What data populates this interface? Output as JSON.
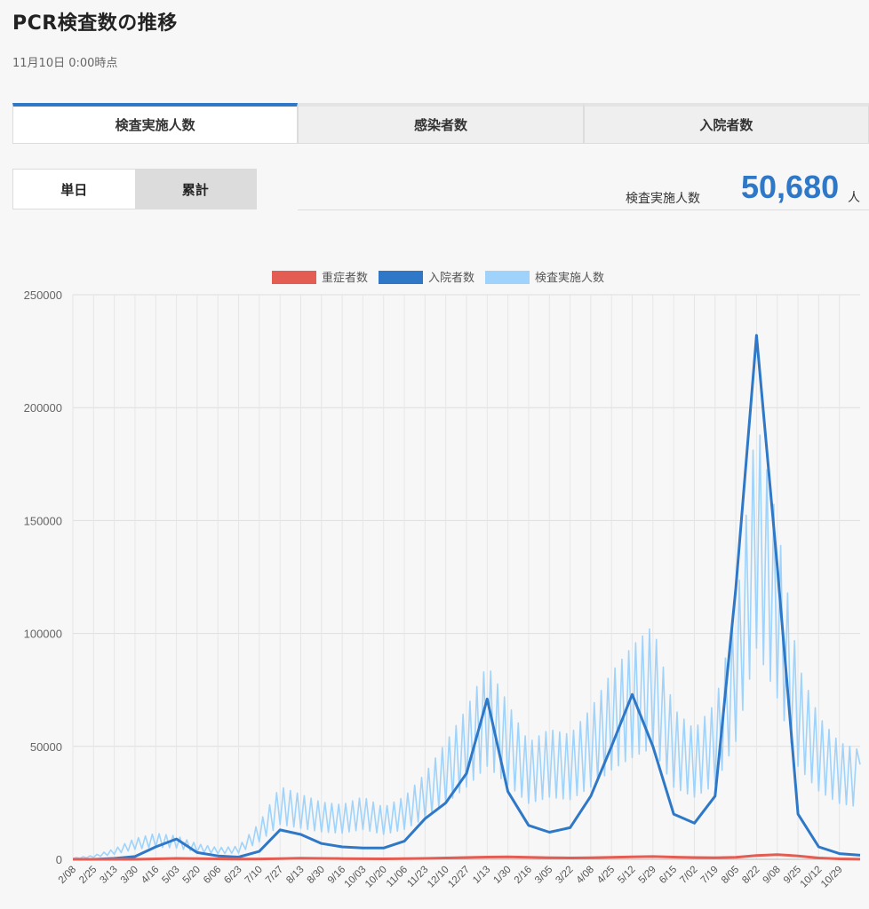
{
  "header": {
    "title": "PCR検査数の推移",
    "timestamp": "11月10日 0:00時点"
  },
  "tabs": [
    {
      "label": "検査実施人数",
      "active": true
    },
    {
      "label": "感染者数",
      "active": false
    },
    {
      "label": "入院者数",
      "active": false
    }
  ],
  "toggle": {
    "daily": "単日",
    "cumulative": "累計",
    "selected": "daily"
  },
  "stat": {
    "label": "検査実施人数",
    "value": "50,680",
    "unit": "人"
  },
  "colors": {
    "severe": "#e35d53",
    "hospitalized": "#2e78c7",
    "tests": "#9fd3fb",
    "accent": "#2e78c7"
  },
  "chart_data": {
    "type": "line",
    "legend": [
      "重症者数",
      "入院者数",
      "検査実施人数"
    ],
    "legend_position": "top",
    "grid": true,
    "ylim": [
      0,
      250000
    ],
    "yticks": [
      "250000",
      "200000",
      "150000",
      "100000",
      "50000",
      "0"
    ],
    "xticks": [
      "2/08",
      "2/25",
      "3/13",
      "3/30",
      "4/16",
      "5/03",
      "5/20",
      "6/06",
      "6/23",
      "7/10",
      "7/27",
      "8/13",
      "8/30",
      "9/16",
      "10/03",
      "10/20",
      "11/06",
      "11/23",
      "12/10",
      "12/27",
      "1/13",
      "1/30",
      "2/16",
      "3/05",
      "3/22",
      "4/08",
      "4/25",
      "5/12",
      "5/29",
      "6/15",
      "7/02",
      "7/19",
      "8/05",
      "8/22",
      "9/08",
      "9/25",
      "10/12",
      "10/29"
    ],
    "series": [
      {
        "name": "重症者数",
        "values": [
          0,
          0,
          0,
          0,
          200,
          400,
          300,
          200,
          100,
          150,
          300,
          500,
          400,
          300,
          250,
          200,
          300,
          400,
          600,
          800,
          1000,
          1100,
          900,
          700,
          600,
          700,
          900,
          1100,
          1200,
          1000,
          800,
          700,
          900,
          1700,
          2100,
          1500,
          600,
          200,
          50
        ]
      },
      {
        "name": "入院者数",
        "values": [
          0,
          0,
          400,
          1200,
          5500,
          9000,
          3000,
          1500,
          1000,
          3500,
          13000,
          11000,
          7000,
          5500,
          5000,
          5000,
          8000,
          18000,
          25000,
          38000,
          71000,
          30000,
          15000,
          12000,
          14000,
          28000,
          50000,
          73000,
          50000,
          20000,
          16000,
          28000,
          120000,
          232000,
          130000,
          20000,
          5500,
          2500,
          1800
        ]
      },
      {
        "name": "検査実施人数",
        "values": [
          500,
          1500,
          4000,
          8000,
          10000,
          9000,
          6000,
          4500,
          5000,
          14000,
          28000,
          25000,
          22000,
          21000,
          24000,
          20000,
          24000,
          33000,
          45000,
          58000,
          75000,
          60000,
          45000,
          50000,
          48000,
          58000,
          72000,
          82000,
          90000,
          58000,
          50000,
          60000,
          95000,
          170000,
          130000,
          75000,
          55000,
          45000,
          42000
        ]
      }
    ]
  }
}
